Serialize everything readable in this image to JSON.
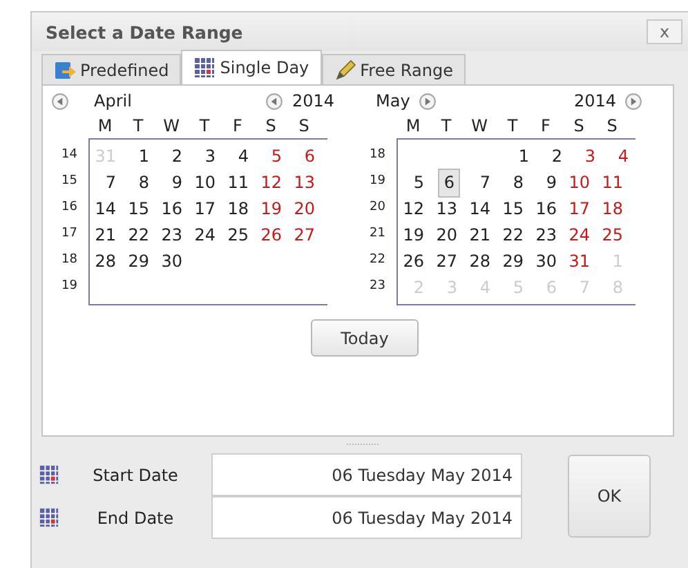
{
  "window": {
    "title": "Select a Date Range",
    "close": "x"
  },
  "tabs": [
    {
      "label": "Predefined",
      "selected": false
    },
    {
      "label": "Single Day",
      "selected": true
    },
    {
      "label": "Free Range",
      "selected": false
    }
  ],
  "months": [
    {
      "month": "April",
      "year": "2014",
      "weekdays": [
        "M",
        "T",
        "W",
        "T",
        "F",
        "S",
        "S"
      ],
      "weeks": [
        {
          "week": "14",
          "days": [
            {
              "text": "31",
              "kind": "other",
              "selected": false
            },
            {
              "text": "1",
              "kind": "normal",
              "selected": false
            },
            {
              "text": "2",
              "kind": "normal",
              "selected": false
            },
            {
              "text": "3",
              "kind": "normal",
              "selected": false
            },
            {
              "text": "4",
              "kind": "normal",
              "selected": false
            },
            {
              "text": "5",
              "kind": "weekend",
              "selected": false
            },
            {
              "text": "6",
              "kind": "weekend",
              "selected": false
            }
          ]
        },
        {
          "week": "15",
          "days": [
            {
              "text": "7",
              "kind": "normal",
              "selected": false
            },
            {
              "text": "8",
              "kind": "normal",
              "selected": false
            },
            {
              "text": "9",
              "kind": "normal",
              "selected": false
            },
            {
              "text": "10",
              "kind": "normal",
              "selected": false
            },
            {
              "text": "11",
              "kind": "normal",
              "selected": false
            },
            {
              "text": "12",
              "kind": "weekend",
              "selected": false
            },
            {
              "text": "13",
              "kind": "weekend",
              "selected": false
            }
          ]
        },
        {
          "week": "16",
          "days": [
            {
              "text": "14",
              "kind": "normal",
              "selected": false
            },
            {
              "text": "15",
              "kind": "normal",
              "selected": false
            },
            {
              "text": "16",
              "kind": "normal",
              "selected": false
            },
            {
              "text": "17",
              "kind": "normal",
              "selected": false
            },
            {
              "text": "18",
              "kind": "normal",
              "selected": false
            },
            {
              "text": "19",
              "kind": "weekend",
              "selected": false
            },
            {
              "text": "20",
              "kind": "weekend",
              "selected": false
            }
          ]
        },
        {
          "week": "17",
          "days": [
            {
              "text": "21",
              "kind": "normal",
              "selected": false
            },
            {
              "text": "22",
              "kind": "normal",
              "selected": false
            },
            {
              "text": "23",
              "kind": "normal",
              "selected": false
            },
            {
              "text": "24",
              "kind": "normal",
              "selected": false
            },
            {
              "text": "25",
              "kind": "normal",
              "selected": false
            },
            {
              "text": "26",
              "kind": "weekend",
              "selected": false
            },
            {
              "text": "27",
              "kind": "weekend",
              "selected": false
            }
          ]
        },
        {
          "week": "18",
          "days": [
            {
              "text": "28",
              "kind": "normal",
              "selected": false
            },
            {
              "text": "29",
              "kind": "normal",
              "selected": false
            },
            {
              "text": "30",
              "kind": "normal",
              "selected": false
            }
          ]
        },
        {
          "week": "19"
        }
      ]
    },
    {
      "month": "May",
      "year": "2014",
      "weekdays": [
        "M",
        "T",
        "W",
        "T",
        "F",
        "S",
        "S"
      ],
      "weeks": [
        {
          "week": "18",
          "days": [
            {
              "text": "1",
              "kind": "normal",
              "selected": false
            },
            {
              "text": "2",
              "kind": "normal",
              "selected": false
            },
            {
              "text": "3",
              "kind": "weekend",
              "selected": false
            },
            {
              "text": "4",
              "kind": "weekend",
              "selected": false
            }
          ]
        },
        {
          "week": "19",
          "days": [
            {
              "text": "5",
              "kind": "normal",
              "selected": false
            },
            {
              "text": "6",
              "kind": "normal",
              "selected": true
            },
            {
              "text": "7",
              "kind": "normal",
              "selected": false
            },
            {
              "text": "8",
              "kind": "normal",
              "selected": false
            },
            {
              "text": "9",
              "kind": "normal",
              "selected": false
            },
            {
              "text": "10",
              "kind": "weekend",
              "selected": false
            },
            {
              "text": "11",
              "kind": "weekend",
              "selected": false
            }
          ]
        },
        {
          "week": "20",
          "days": [
            {
              "text": "12",
              "kind": "normal",
              "selected": false
            },
            {
              "text": "13",
              "kind": "normal",
              "selected": false
            },
            {
              "text": "14",
              "kind": "normal",
              "selected": false
            },
            {
              "text": "15",
              "kind": "normal",
              "selected": false
            },
            {
              "text": "16",
              "kind": "normal",
              "selected": false
            },
            {
              "text": "17",
              "kind": "weekend",
              "selected": false
            },
            {
              "text": "18",
              "kind": "weekend",
              "selected": false
            }
          ]
        },
        {
          "week": "21",
          "days": [
            {
              "text": "19",
              "kind": "normal",
              "selected": false
            },
            {
              "text": "20",
              "kind": "normal",
              "selected": false
            },
            {
              "text": "21",
              "kind": "normal",
              "selected": false
            },
            {
              "text": "22",
              "kind": "normal",
              "selected": false
            },
            {
              "text": "23",
              "kind": "normal",
              "selected": false
            },
            {
              "text": "24",
              "kind": "weekend",
              "selected": false
            },
            {
              "text": "25",
              "kind": "weekend",
              "selected": false
            }
          ]
        },
        {
          "week": "22",
          "days": [
            {
              "text": "26",
              "kind": "normal",
              "selected": false
            },
            {
              "text": "27",
              "kind": "normal",
              "selected": false
            },
            {
              "text": "28",
              "kind": "normal",
              "selected": false
            },
            {
              "text": "29",
              "kind": "normal",
              "selected": false
            },
            {
              "text": "30",
              "kind": "normal",
              "selected": false
            },
            {
              "text": "31",
              "kind": "weekend",
              "selected": false
            },
            {
              "text": "1",
              "kind": "other",
              "selected": false
            }
          ]
        },
        {
          "week": "23",
          "days": [
            {
              "text": "2",
              "kind": "other",
              "selected": false
            },
            {
              "text": "3",
              "kind": "other",
              "selected": false
            },
            {
              "text": "4",
              "kind": "other",
              "selected": false
            },
            {
              "text": "5",
              "kind": "other",
              "selected": false
            },
            {
              "text": "6",
              "kind": "other",
              "selected": false
            },
            {
              "text": "7",
              "kind": "other",
              "selected": false
            },
            {
              "text": "8",
              "kind": "other",
              "selected": false
            }
          ]
        }
      ]
    }
  ],
  "today_button": "Today",
  "fields": [
    {
      "label": "Start Date",
      "value": "06 Tuesday May 2014"
    },
    {
      "label": "End Date",
      "value": "06 Tuesday May 2014"
    }
  ],
  "ok_button": "OK"
}
